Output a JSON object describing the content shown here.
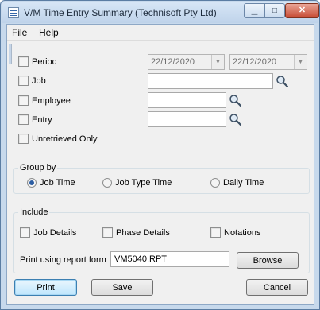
{
  "window": {
    "title": "V/M Time Entry Summary (Technisoft Pty Ltd)",
    "minimize_glyph": "▁",
    "maximize_glyph": "□",
    "close_glyph": "✕"
  },
  "menu": {
    "file": "File",
    "help": "Help"
  },
  "filters": {
    "period": {
      "label": "Period",
      "checked": false,
      "from": "22/12/2020",
      "to": "22/12/2020"
    },
    "job": {
      "label": "Job",
      "checked": false,
      "value": ""
    },
    "employee": {
      "label": "Employee",
      "checked": false,
      "value": ""
    },
    "entry": {
      "label": "Entry",
      "checked": false,
      "value": ""
    },
    "unretrieved": {
      "label": "Unretrieved Only",
      "checked": false
    }
  },
  "group_by": {
    "title": "Group by",
    "options": [
      {
        "label": "Job Time",
        "selected": true
      },
      {
        "label": "Job Type Time",
        "selected": false
      },
      {
        "label": "Daily Time",
        "selected": false
      }
    ]
  },
  "include": {
    "title": "Include",
    "job_details": "Job Details",
    "phase_details": "Phase Details",
    "notations": "Notations",
    "report_form_label": "Print using report form",
    "report_form_value": "VM5040.RPT",
    "browse": "Browse"
  },
  "actions": {
    "print": "Print",
    "save": "Save",
    "cancel": "Cancel"
  },
  "icons": {
    "app": "app-icon",
    "lookup": "magnifier-icon",
    "dropdown": "chevron-down-icon"
  }
}
